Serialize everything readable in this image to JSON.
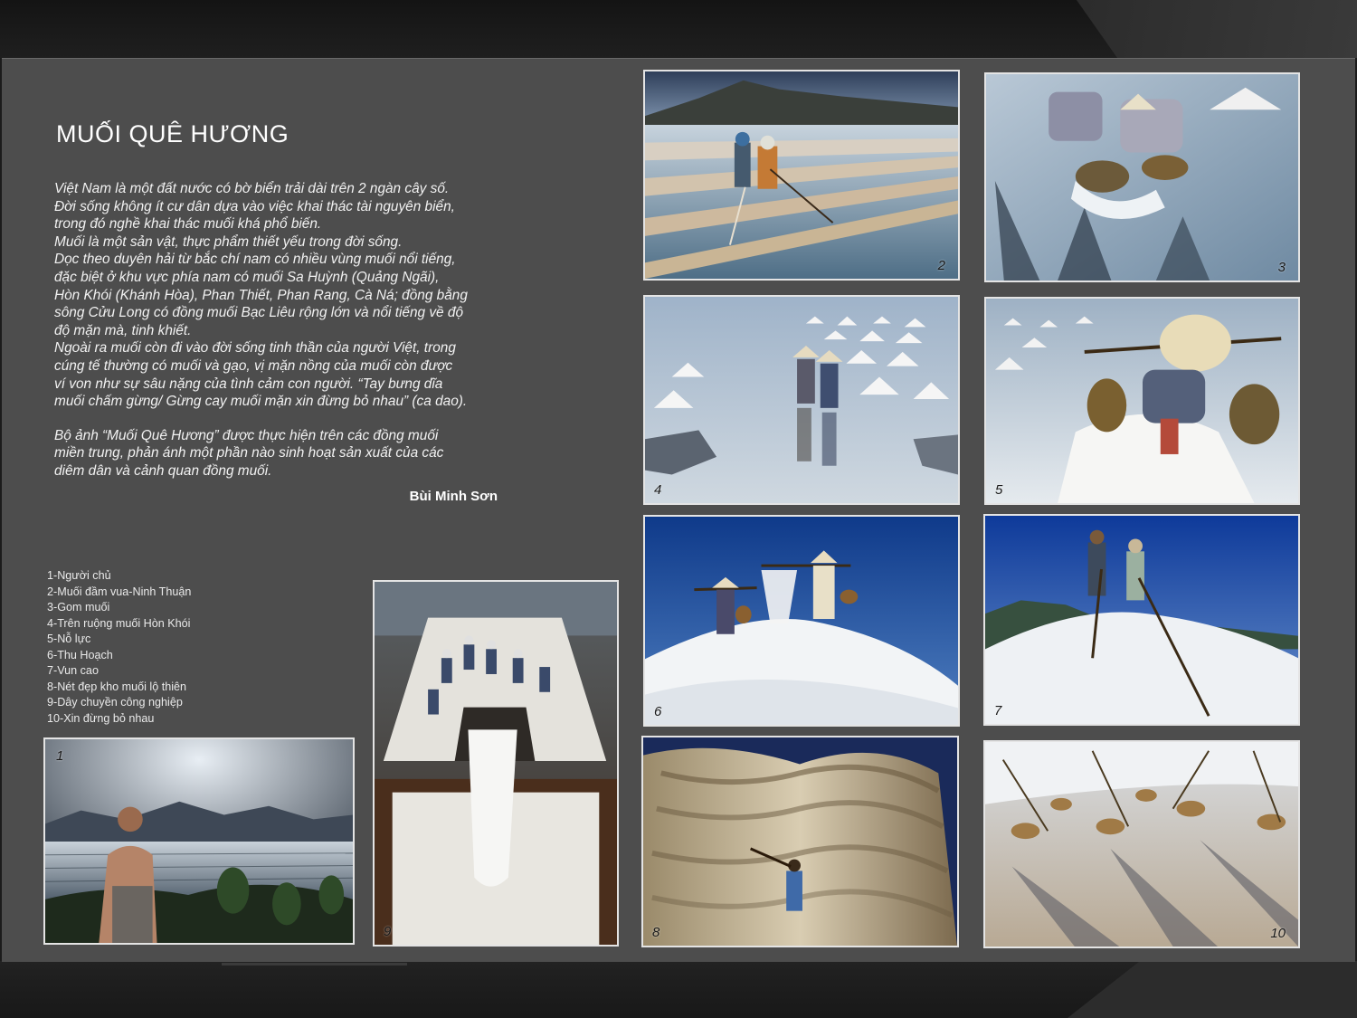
{
  "title": "MUỐI QUÊ HƯƠNG",
  "intro_lines": [
    "Việt Nam là một đất nước có bờ biển trải dài trên 2 ngàn cây số.",
    "Đời sống không ít cư dân dựa vào việc khai thác tài nguyên biển,",
    "trong đó nghề khai thác muối khá phổ biến.",
    "Muối là một sản vật, thực phẩm thiết yếu trong đời sống.",
    "Dọc theo duyên hải từ bắc chí nam có nhiều vùng muối nổi tiếng,",
    "đặc biệt ở khu vực phía nam có muối Sa Huỳnh (Quảng Ngãi),",
    "Hòn Khói (Khánh Hòa), Phan Thiết, Phan Rang, Cà Ná; đồng bằng",
    "sông Cửu Long có  đồng muối Bạc Liêu rộng lớn và nổi tiếng về độ",
    "độ mặn mà, tinh khiết.",
    "Ngoài ra muối còn đi vào đời sống tinh thần của người Việt, trong",
    "cúng tế thường có muối và gạo, vị mặn nồng của muối còn được",
    "ví von như sự sâu nặng của tình cảm con người. “Tay bưng dĩa",
    "muối chấm gừng/ Gừng cay muối mặn xin đừng bỏ nhau” (ca dao)."
  ],
  "outro_lines": [
    "Bộ ảnh “Muối Quê Hương” được thực hiện trên các đồng muối",
    "miền trung, phản ánh một phần nào sinh hoạt sản xuất của các",
    " diêm dân và cảnh quan đồng muối."
  ],
  "author": "Bùi Minh Sơn",
  "captions": [
    "1-Người chủ",
    "2-Muối đầm vua-Ninh Thuận",
    "3-Gom muối",
    "4-Trên ruộng muối Hòn Khói",
    "5-Nỗ lực",
    "6-Thu Hoạch",
    "7-Vun cao",
    "8-Nét đẹp kho muối lộ thiên",
    "9-Dây chuyền công nghiệp",
    "10-Xin đừng bỏ nhau"
  ],
  "photo_numbers": {
    "p1": "1",
    "p2": "2",
    "p3": "3",
    "p4": "4",
    "p5": "5",
    "p6": "6",
    "p7": "7",
    "p8": "8",
    "p9": "9",
    "p10": "10"
  },
  "colors": {
    "panel": "#4d4d4d",
    "frame": "#e4e4e4",
    "text": "#ffffff"
  }
}
